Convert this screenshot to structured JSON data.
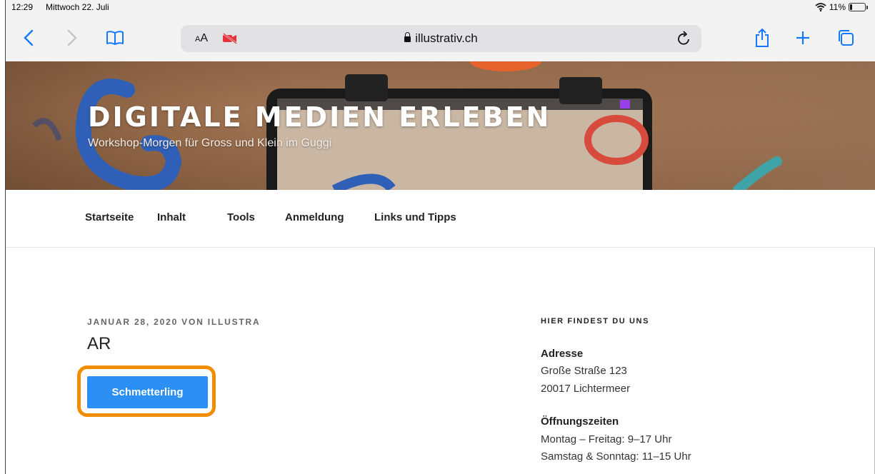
{
  "status": {
    "time": "12:29",
    "date": "Mittwoch 22. Juli",
    "battery": "11%"
  },
  "browser": {
    "text_size_label": "AA",
    "url": "illustrativ.ch",
    "accent_color": "#1479ff"
  },
  "site": {
    "title": "DIGITALE MEDIEN ERLEBEN",
    "subtitle": "Workshop-Morgen für Gross und Klein im Guggi"
  },
  "nav": {
    "items": [
      "Startseite",
      "Inhalt",
      "Tools",
      "Anmeldung",
      "Links und Tipps"
    ]
  },
  "post": {
    "meta": "JANUAR 28, 2020 VON ILLUSTRA",
    "title": "AR",
    "button_label": "Schmetterling",
    "button_color": "#2b8ff3",
    "highlight_color": "#f28c00"
  },
  "sidebar": {
    "heading": "HIER FINDEST DU UNS",
    "address_label": "Adresse",
    "address_line1": "Große Straße 123",
    "address_line2": "20017 Lichtermeer",
    "hours_label": "Öffnungszeiten",
    "hours_line1": "Montag – Freitag: 9–17 Uhr",
    "hours_line2": "Samstag & Sonntag: 11–15 Uhr"
  }
}
